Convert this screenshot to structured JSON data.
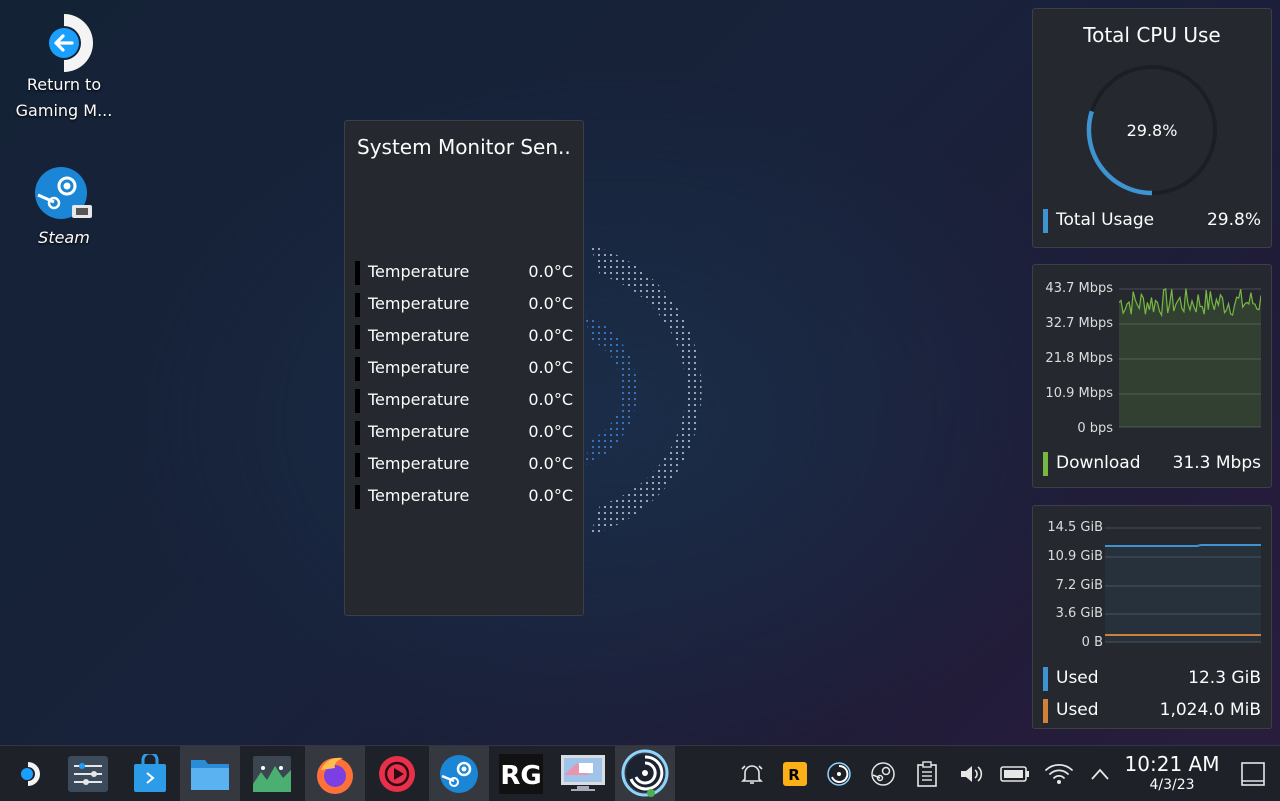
{
  "desktop": {
    "icons": [
      {
        "label_line1": "Return to",
        "label_line2": "Gaming M..."
      },
      {
        "label": "Steam"
      }
    ]
  },
  "sensors": {
    "title": "System Monitor Sen...",
    "rows": [
      {
        "label": "Temperature",
        "value": "0.0°C"
      },
      {
        "label": "Temperature",
        "value": "0.0°C"
      },
      {
        "label": "Temperature",
        "value": "0.0°C"
      },
      {
        "label": "Temperature",
        "value": "0.0°C"
      },
      {
        "label": "Temperature",
        "value": "0.0°C"
      },
      {
        "label": "Temperature",
        "value": "0.0°C"
      },
      {
        "label": "Temperature",
        "value": "0.0°C"
      },
      {
        "label": "Temperature",
        "value": "0.0°C"
      }
    ]
  },
  "cpu": {
    "title": "Total CPU Use",
    "center_value": "29.8%",
    "fraction": 0.298,
    "legend_label": "Total Usage",
    "legend_value": "29.8%",
    "color": "#3d94d1"
  },
  "network": {
    "axis": [
      "43.7 Mbps",
      "32.7 Mbps",
      "21.8 Mbps",
      "10.9 Mbps",
      "0 bps"
    ],
    "legend_label": "Download",
    "legend_value": "31.3 Mbps",
    "color": "#77b843"
  },
  "memory": {
    "axis": [
      "14.5 GiB",
      "10.9 GiB",
      "7.2 GiB",
      "3.6 GiB",
      "0 B"
    ],
    "legend": [
      {
        "label": "Used",
        "value": "12.3 GiB",
        "color": "#3d94d1"
      },
      {
        "label": "Used",
        "value": "1,024.0 MiB",
        "color": "#d3803a"
      }
    ]
  },
  "taskbar": {
    "apps": [
      "launcher-icon",
      "settings-icon",
      "discover-store-icon",
      "file-manager-icon",
      "system-monitor-icon",
      "firefox-icon",
      "media-player-icon",
      "steam-icon",
      "rg-app-icon",
      "screenshot-app-icon",
      "ubisoft-icon"
    ],
    "tray": [
      "notifications-icon",
      "rockstar-icon",
      "ubisoft-tray-icon",
      "steam-tray-icon",
      "clipboard-icon",
      "volume-icon",
      "battery-icon",
      "wifi-icon",
      "expand-tray-icon"
    ],
    "time": "10:21 AM",
    "date": "4/3/23"
  }
}
